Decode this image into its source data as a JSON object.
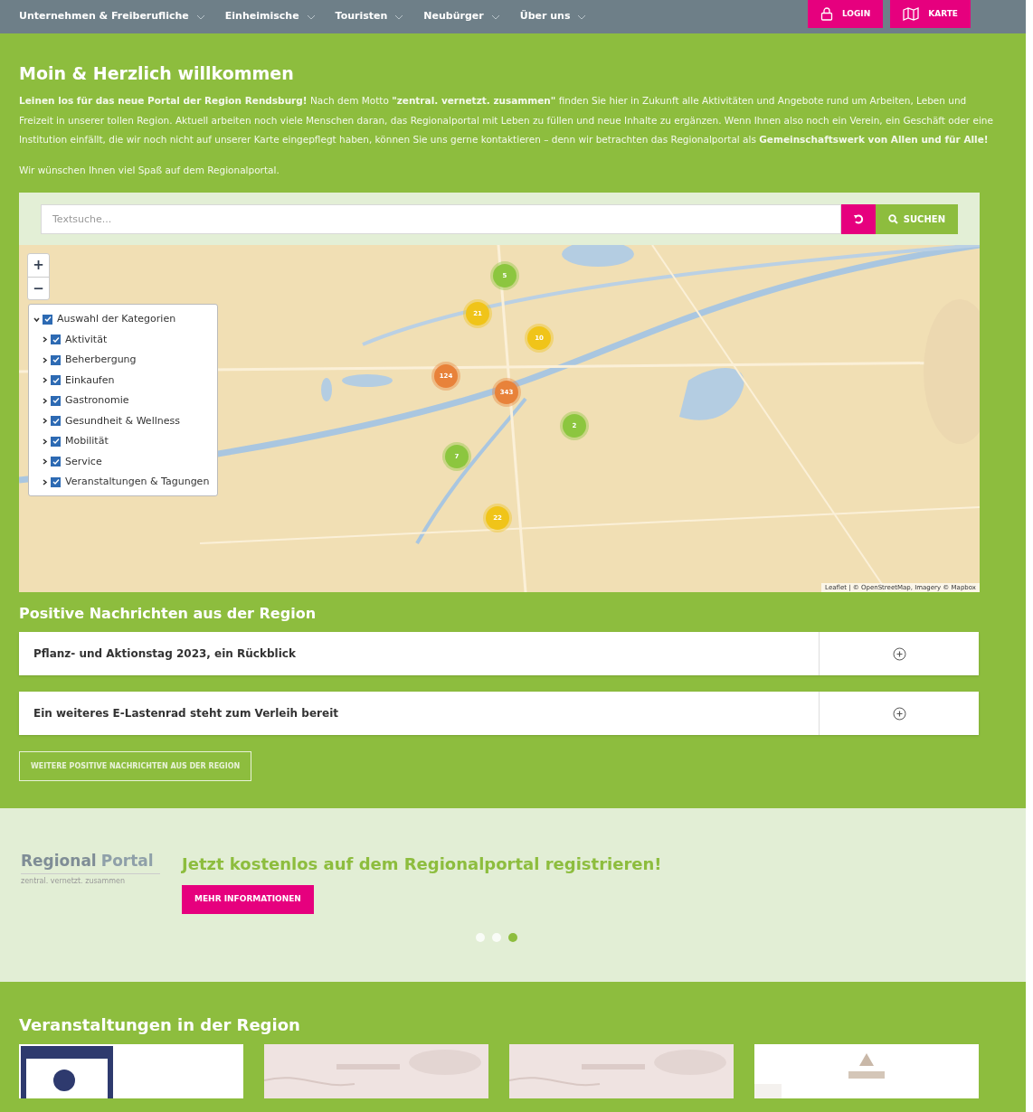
{
  "nav": {
    "items": [
      {
        "label": "Unternehmen & Freiberufliche"
      },
      {
        "label": "Einheimische"
      },
      {
        "label": "Touristen"
      },
      {
        "label": "Neubürger"
      },
      {
        "label": "Über uns"
      }
    ],
    "buttons": [
      {
        "label": "LOGIN",
        "kind": "login"
      },
      {
        "label": "KARTE",
        "kind": "map"
      }
    ]
  },
  "welcome": {
    "title": "Moin & Herzlich willkommen",
    "paragraphs": [
      "**Leinen los für das neue Portal der Region Rendsburg!** Nach dem Motto **\"zentral. vernetzt. zusammen\"** finden Sie hier in Zukunft alle Aktivitäten und Angebote rund um Arbeiten, Leben und Freizeit in unserer tollen Region. Aktuell arbeiten noch viele Menschen daran, das Regionalportal mit Leben zu füllen und neue Inhalte zu ergänzen. Wenn Ihnen also noch ein Verein, ein Geschäft oder eine Institution einfällt, die wir noch nicht auf unserer Karte eingepflegt haben, können Sie uns gerne kontaktieren – denn wir betrachten das Regionalportal als **Gemeinschaftswerk von Allen und für Alle!**",
      "Wir wünschen Ihnen viel Spaß auf dem Regionalportal."
    ]
  },
  "map": {
    "search": {
      "placeholder": "Textsuche...",
      "button": "SUCHEN"
    },
    "zoom": [
      "+",
      "−"
    ],
    "layers": {
      "label": "Auswahl der Kategorien",
      "checked": true,
      "expanded": true,
      "children": [
        {
          "label": "Aktivität",
          "checked": true,
          "expanded": false
        },
        {
          "label": "Beherbergung",
          "checked": true,
          "expanded": false
        },
        {
          "label": "Einkaufen",
          "checked": true,
          "expanded": false
        },
        {
          "label": "Gastronomie",
          "checked": true,
          "expanded": false
        },
        {
          "label": "Gesundheit & Wellness",
          "checked": true,
          "expanded": false
        },
        {
          "label": "Mobilität",
          "checked": true,
          "expanded": false
        },
        {
          "label": "Service",
          "checked": true,
          "expanded": false
        },
        {
          "label": "Veranstaltungen & Tagungen",
          "checked": true,
          "expanded": false
        }
      ]
    },
    "clusters": [
      {
        "count": "5",
        "color": "#8cc63f"
      },
      {
        "count": "21",
        "color": "#f0c419"
      },
      {
        "count": "10",
        "color": "#f0c419"
      },
      {
        "count": "124",
        "color": "#e8823a"
      },
      {
        "count": "343",
        "color": "#e8823a"
      },
      {
        "count": "2",
        "color": "#8cc63f"
      },
      {
        "count": "7",
        "color": "#8cc63f"
      },
      {
        "count": "22",
        "color": "#f0c419"
      }
    ],
    "attribution": "Leaflet | © OpenStreetMap, Imagery © Mapbox"
  },
  "news": {
    "title": "Positive Nachrichten aus der Region",
    "items": [
      {
        "title": "Pflanz- und Aktionstag 2023, ein Rückblick",
        "expanded": false
      },
      {
        "title": "Ein weiteres E-Lastenrad steht zum Verleih bereit",
        "expanded": false
      }
    ],
    "more": "WEITERE POSITIVE NACHRICHTEN AUS DER REGION"
  },
  "banner": {
    "logo_word_1": "Regional",
    "logo_word_2": "Portal",
    "logo_tagline": "zentral. vernetzt. zusammen",
    "headline": "Jetzt kostenlos auf dem Regionalportal registrieren!",
    "button": "MEHR INFORMATIONEN",
    "dots": [
      {
        "selected": false
      },
      {
        "selected": false
      },
      {
        "selected": true
      }
    ]
  },
  "events": {
    "title": "Veranstaltungen in der Region"
  }
}
